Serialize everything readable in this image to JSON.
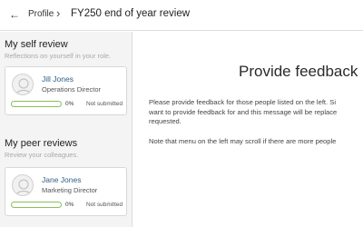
{
  "header": {
    "back_icon": "arrow-left-icon",
    "back_glyph": "←",
    "back_label": "Profile",
    "separator": "›",
    "title": "FY250 end of year review"
  },
  "sidebar": {
    "self_review": {
      "title": "My self review",
      "subtitle": "Reflections on yourself in your role.",
      "card": {
        "name": "Jill Jones",
        "role": "Operations Director",
        "progress_value": 0,
        "progress_label": "0%",
        "status": "Not submitted"
      }
    },
    "peer_reviews": {
      "title": "My peer reviews",
      "subtitle": "Review your colleagues.",
      "cards": [
        {
          "name": "Jane Jones",
          "role": "Marketing Director",
          "progress_value": 0,
          "progress_label": "0%",
          "status": "Not submitted"
        }
      ]
    }
  },
  "main": {
    "heading": "Provide feedback",
    "paragraph1_line1": "Please provide feedback for those people listed on the left. Si",
    "paragraph1_line2": "want to provide feedback for and this message will be replace",
    "paragraph1_line3": "requested.",
    "paragraph2": "Note that menu on the left may scroll if there are more people"
  },
  "colors": {
    "accent_green": "#8cbf5a",
    "name_blue": "#2f5e86",
    "sidebar_bg": "#f4f4f4"
  }
}
